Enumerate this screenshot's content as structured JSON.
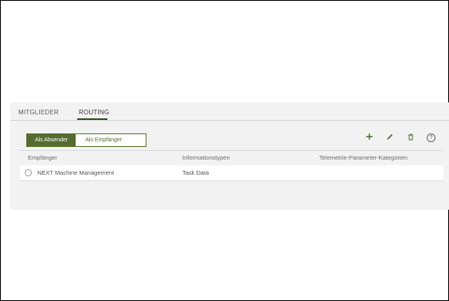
{
  "tabs": [
    {
      "label": "MITGLIEDER",
      "active": false
    },
    {
      "label": "ROUTING",
      "active": true
    }
  ],
  "toggle": {
    "sender_label": "Als Absender",
    "receiver_label": "Als Empfänger",
    "selected": "Als Absender"
  },
  "toolbar": {
    "icons": [
      "plus-icon",
      "pencil-icon",
      "trash-icon",
      "help-icon"
    ],
    "help_glyph": "?"
  },
  "table": {
    "columns": [
      "Empfänger",
      "Informationstypen",
      "Telemetrie-Parameter-Kategorien"
    ],
    "rows": [
      {
        "selected": false,
        "cells": [
          "NEXT Machine Management",
          "Task Data",
          ""
        ]
      }
    ]
  },
  "colors": {
    "accent": "#556b2f",
    "panel_bg": "#f2f2f2"
  }
}
